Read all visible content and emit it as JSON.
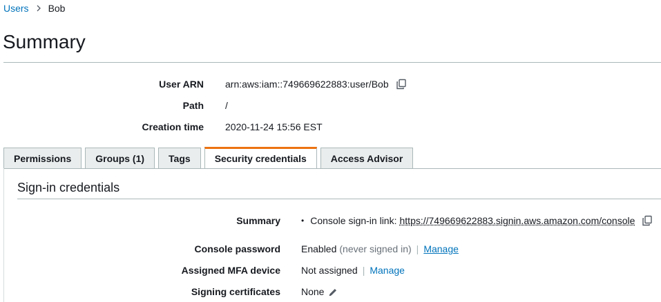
{
  "breadcrumb": {
    "parent": "Users",
    "current": "Bob"
  },
  "page": {
    "title": "Summary"
  },
  "summary": {
    "user_arn_label": "User ARN",
    "user_arn_value": "arn:aws:iam::749669622883:user/Bob",
    "path_label": "Path",
    "path_value": "/",
    "creation_time_label": "Creation time",
    "creation_time_value": "2020-11-24 15:56 EST"
  },
  "tabs": [
    {
      "label": "Permissions",
      "active": false
    },
    {
      "label": "Groups (1)",
      "active": false
    },
    {
      "label": "Tags",
      "active": false
    },
    {
      "label": "Security credentials",
      "active": true
    },
    {
      "label": "Access Advisor",
      "active": false
    }
  ],
  "signin": {
    "section_title": "Sign-in credentials",
    "summary_label": "Summary",
    "console_link_prefix": "Console sign-in link:",
    "console_link_url": "https://749669622883.signin.aws.amazon.com/console",
    "console_password_label": "Console password",
    "console_password_status": "Enabled",
    "console_password_note": "(never signed in)",
    "console_password_manage": "Manage",
    "mfa_label": "Assigned MFA device",
    "mfa_status": "Not assigned",
    "mfa_manage": "Manage",
    "signing_certs_label": "Signing certificates",
    "signing_certs_value": "None"
  },
  "colors": {
    "link": "#0073bb",
    "active_tab_accent": "#ec7211",
    "tab_background": "#eaeded",
    "divider": "#aab7b8"
  },
  "icons": {
    "copy": "copy-icon",
    "edit": "pencil-icon",
    "breadcrumb_separator": "chevron-right-icon"
  }
}
